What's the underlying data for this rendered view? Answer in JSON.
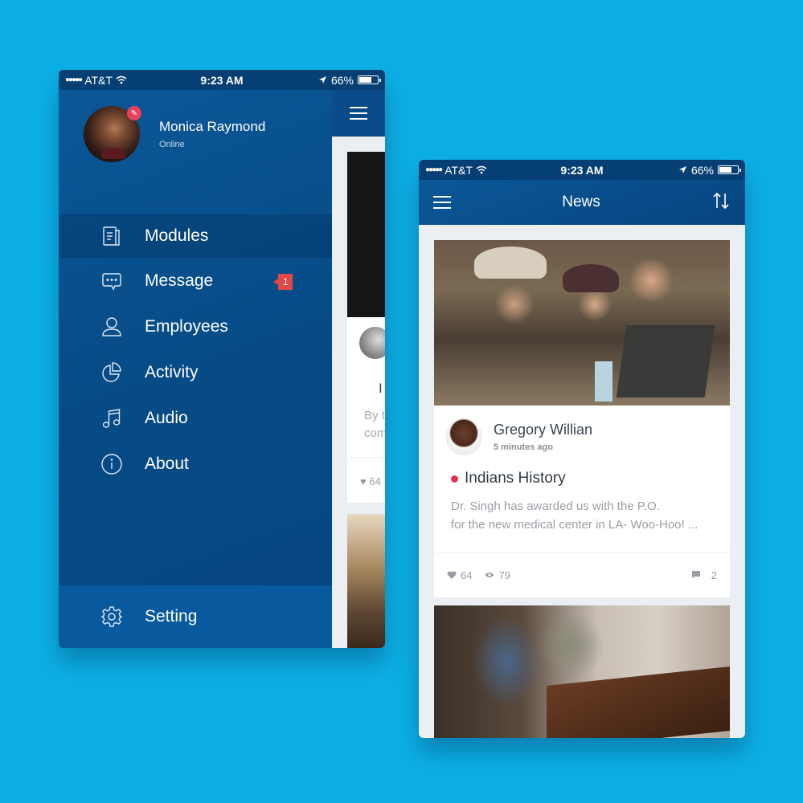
{
  "status_bar": {
    "carrier": "AT&T",
    "time": "9:23 AM",
    "battery": "66%",
    "battery_level": 0.66
  },
  "menu_screen": {
    "profile": {
      "name": "Monica Raymond",
      "status": "Online"
    },
    "menu_items": [
      {
        "label": "Modules",
        "icon": "document-icon",
        "active": true
      },
      {
        "label": "Message",
        "icon": "chat-bubble-icon",
        "badge": "1"
      },
      {
        "label": "Employees",
        "icon": "person-icon"
      },
      {
        "label": "Activity",
        "icon": "pie-chart-icon"
      },
      {
        "label": "Audio",
        "icon": "music-note-icon"
      },
      {
        "label": "About",
        "icon": "info-icon"
      }
    ],
    "footer_item": {
      "label": "Setting",
      "icon": "gear-icon"
    },
    "peek": {
      "title_fragment": "I",
      "text_line1": "By t",
      "text_line2": "com",
      "likes_fragment": "64"
    }
  },
  "news_screen": {
    "title": "News",
    "posts": [
      {
        "author": "Gregory Willian",
        "time": "5 minutes ago",
        "title": "Indians History",
        "category_color": "#e03055",
        "text_line1": "Dr. Singh has awarded us with the P.O.",
        "text_line2": "for the new medical center in LA- Woo-Hoo! ...",
        "likes": "64",
        "views": "79",
        "comments": "2"
      }
    ]
  },
  "colors": {
    "background": "#0cb0e6",
    "primary": "#0a4c8a",
    "badge": "#e04848",
    "accent_dot": "#e03055"
  }
}
